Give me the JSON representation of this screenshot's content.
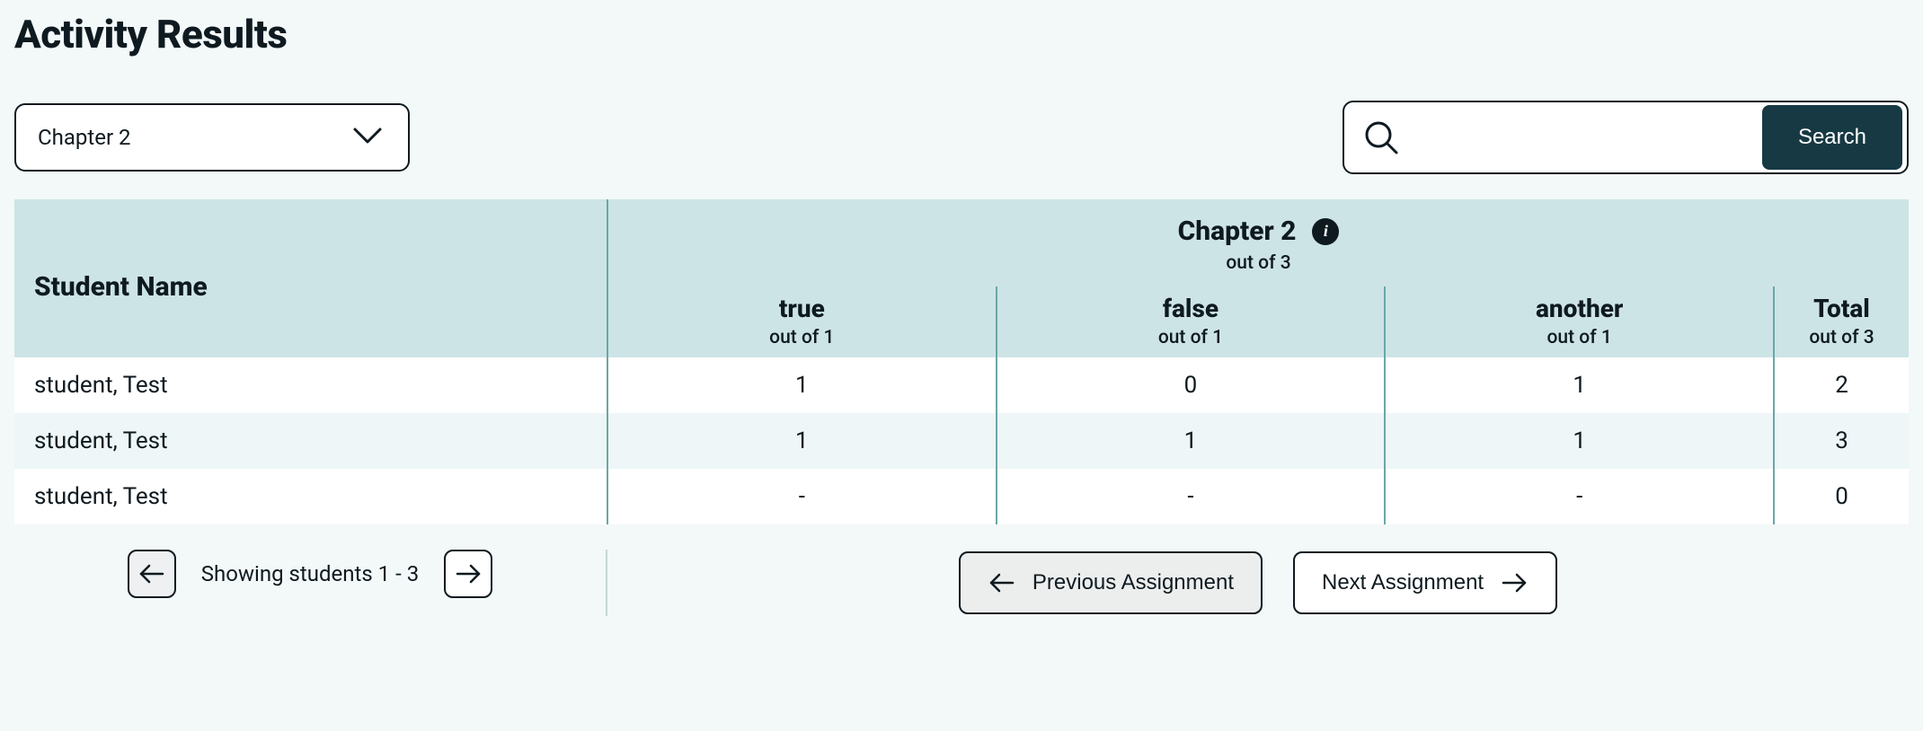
{
  "title": "Activity Results",
  "selector": {
    "selected": "Chapter 2"
  },
  "search": {
    "button_label": "Search",
    "value": ""
  },
  "table": {
    "name_header": "Student Name",
    "chapter_title": "Chapter 2",
    "chapter_outof": "out of 3",
    "columns": [
      {
        "name": "true",
        "outof": "out of 1"
      },
      {
        "name": "false",
        "outof": "out of 1"
      },
      {
        "name": "another",
        "outof": "out of 1"
      }
    ],
    "total": {
      "name": "Total",
      "outof": "out of 3"
    },
    "rows": [
      {
        "name": "student, Test",
        "values": [
          "1",
          "0",
          "1"
        ],
        "total": "2"
      },
      {
        "name": "student, Test",
        "values": [
          "1",
          "1",
          "1"
        ],
        "total": "3"
      },
      {
        "name": "student, Test",
        "values": [
          "-",
          "-",
          "-"
        ],
        "total": "0"
      }
    ]
  },
  "pagination": {
    "text": "Showing students 1 - 3"
  },
  "nav": {
    "prev": "Previous Assignment",
    "next": "Next Assignment"
  }
}
